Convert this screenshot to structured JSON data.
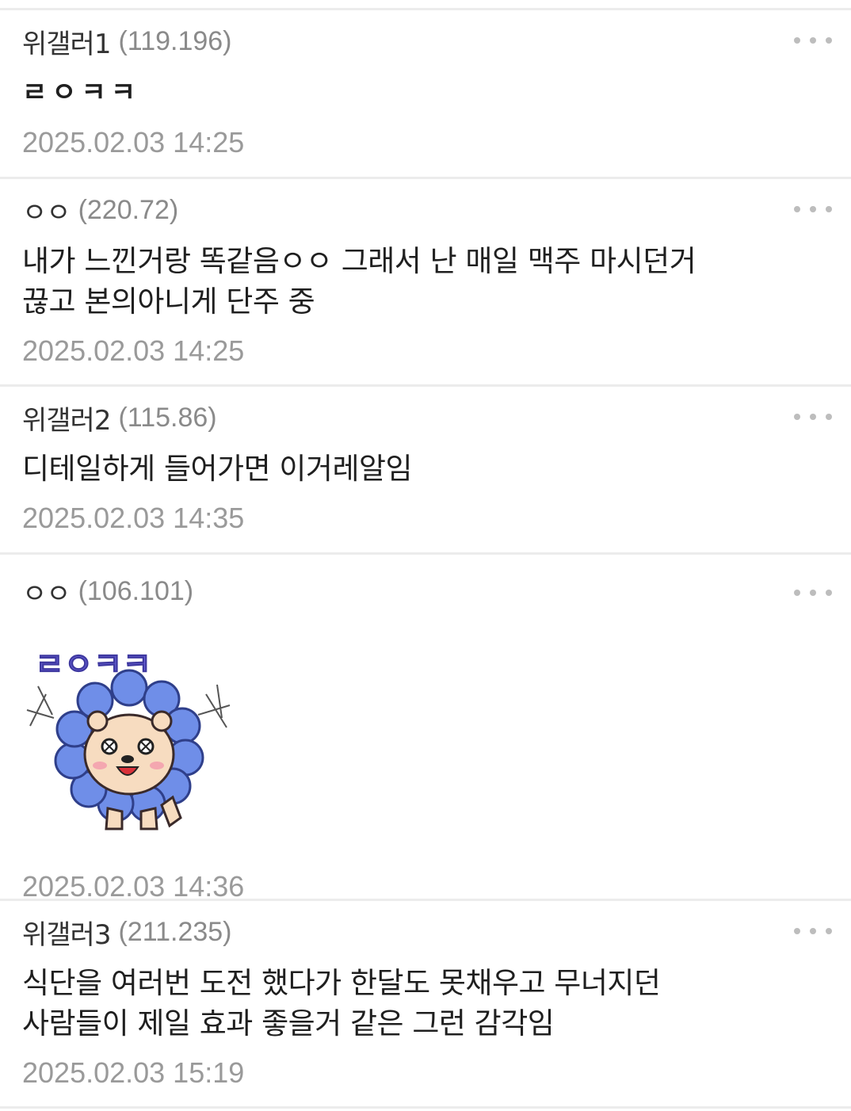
{
  "comments": [
    {
      "nick": "위갤러1",
      "ip": "(119.196)",
      "body": "ㄹㅇㅋㅋ",
      "date": "2025.02.03 14:25"
    },
    {
      "nick": "ㅇㅇ",
      "ip": "(220.72)",
      "body": "내가 느낀거랑 똑같음ㅇㅇ 그래서 난 매일 맥주 마시던거\n끊고 본의아니게 단주 중",
      "date": "2025.02.03 14:25"
    },
    {
      "nick": "위갤러2",
      "ip": "(115.86)",
      "body": "디테일하게 들어가면 이거레알임",
      "date": "2025.02.03 14:35"
    },
    {
      "nick": "ㅇㅇ",
      "ip": "(106.101)",
      "sticker": {
        "text": "ㄹㅇㅋㅋ",
        "icon": "lion-sticker"
      },
      "date": "2025.02.03 14:36"
    },
    {
      "nick": "위갤러3",
      "ip": "(211.235)",
      "body": "식단을 여러번 도전 했다가 한달도 못채우고 무너지던\n사람들이 제일 효과 좋을거 같은 그런 감각임",
      "date": "2025.02.03 15:19"
    }
  ],
  "more_icon": "more-dots-icon",
  "colors": {
    "separator": "#ececec",
    "date": "#9a9a9a",
    "ip": "#8a8a8a",
    "sticker_text": "#6a63d8",
    "petal": "#6f8ee8"
  }
}
